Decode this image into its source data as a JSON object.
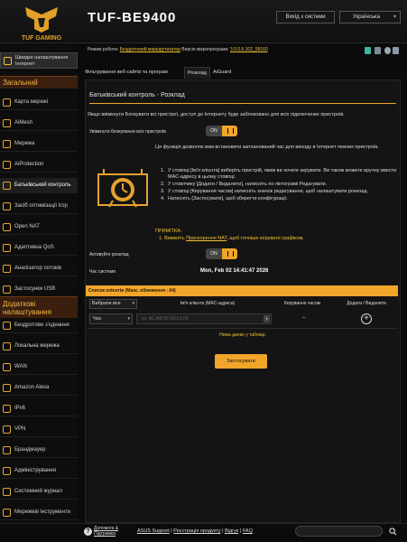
{
  "header": {
    "brand": "TUF GAMING",
    "model": "TUF-BE9400",
    "logout_label": "Вихід з системи",
    "language": "Українська"
  },
  "infobar": {
    "mode_label": "Режим роботи:",
    "mode_value": "Бездротовий маршрутизатор",
    "firmware_label": "Версія мікропрограми:",
    "firmware_value": "3.0.0.6.102_58160"
  },
  "sidebar": {
    "quick_setup": "Швидке налаштування Інтернет",
    "general_header": "Загальний",
    "general_items": [
      {
        "label": "Карта мережі",
        "icon": "network-map-icon"
      },
      {
        "label": "AiMesh",
        "icon": "mesh-icon"
      },
      {
        "label": "Мережа",
        "icon": "network-icon"
      },
      {
        "label": "AiProtection",
        "icon": "shield-icon"
      },
      {
        "label": "Батьківський контроль",
        "icon": "parental-icon"
      },
      {
        "label": "Засіб оптимізації ігор",
        "icon": "game-boost-icon"
      },
      {
        "label": "Open NAT",
        "icon": "open-nat-icon"
      },
      {
        "label": "Адаптивна QoS",
        "icon": "qos-icon"
      },
      {
        "label": "Аналізатор потоків",
        "icon": "traffic-icon"
      },
      {
        "label": "Застосунки USB",
        "icon": "usb-icon"
      }
    ],
    "advanced_header": "Додаткові налаштування",
    "advanced_items": [
      {
        "label": "Бездротове з'єднання",
        "icon": "wireless-icon"
      },
      {
        "label": "Локальна мережа",
        "icon": "lan-icon"
      },
      {
        "label": "WAN",
        "icon": "globe-icon"
      },
      {
        "label": "Amazon Alexa",
        "icon": "alexa-icon"
      },
      {
        "label": "IPv6",
        "icon": "ipv6-icon"
      },
      {
        "label": "VPN",
        "icon": "vpn-icon"
      },
      {
        "label": "Брандмауер",
        "icon": "firewall-icon"
      },
      {
        "label": "Адміністрування",
        "icon": "admin-icon"
      },
      {
        "label": "Системний журнал",
        "icon": "log-icon"
      },
      {
        "label": "Мережеві інструменти",
        "icon": "tools-icon"
      }
    ]
  },
  "tabs": [
    {
      "label": "Фільтрування веб-сайтів та програм"
    },
    {
      "label": "Розклад"
    },
    {
      "label": "AiGuard"
    }
  ],
  "main": {
    "title": "Батьківський контроль - Розклад",
    "intro": "Якщо ввімкнути Блокувати всі пристрої, доступ до Інтернету буде заблоковано для всіх підключених пристроїв.",
    "block_all_label": "Увімкнути блокування всіх пристроїв",
    "toggle_on": "ON",
    "description": "Ця функція дозволяє вам встановити запланований час для виходу в Інтернет певних пристроїв.",
    "steps": [
      {
        "num": "1.",
        "text": "У стовпці [Ім'я клієнта] виберіть пристрій, яким ви хочете керувати. Ви також можете вручну ввести MAC-адресу в цьому стовпці."
      },
      {
        "num": "2.",
        "text": "У стовпчику [Додати / Видалити], натисніть по піктограмі Редагувати."
      },
      {
        "num": "3.",
        "text": "У стовпці [Керування часом] натисніть значок редагування, щоб налаштувати розклад."
      },
      {
        "num": "4.",
        "text": "Натисніть [Застосувати], щоб зберегти конфігурації."
      }
    ],
    "notes_head": "ПРИМІТКА:",
    "notes_pre": "1. Вимкніть ",
    "notes_link": "Прискорення NAT",
    "notes_post": ", щоб точніше керувати графіком.",
    "schedule_label": "Активуйте розклад",
    "systime_label": "Час системи",
    "systime_value": "Mon, Feb 02 14:41:47 2026"
  },
  "client_table": {
    "header": "Список клієнтів (Макс. обмеження : 64)",
    "select_all": "Вибрати все",
    "col_client": "Ім'я клієнта (MAC-адреса)",
    "col_time": "Керування часом",
    "col_addremove": "Додати / Видалити",
    "time_value": "Час",
    "mac_placeholder": "ex: AC:AD:9F:E8:61:00",
    "time_cell": "–",
    "no_data": "Нема даних у таблиці.",
    "apply": "Застосувати"
  },
  "footer": {
    "help": "Допомога & Підтримка",
    "support": "ASUS Support",
    "register": "Реєстрація продукту",
    "feedback": "Відгук",
    "faq": "FAQ",
    "sep": " | "
  },
  "colors": {
    "accent": "#f1a52b",
    "link": "#f1c232",
    "background": "#0b0b0b"
  }
}
